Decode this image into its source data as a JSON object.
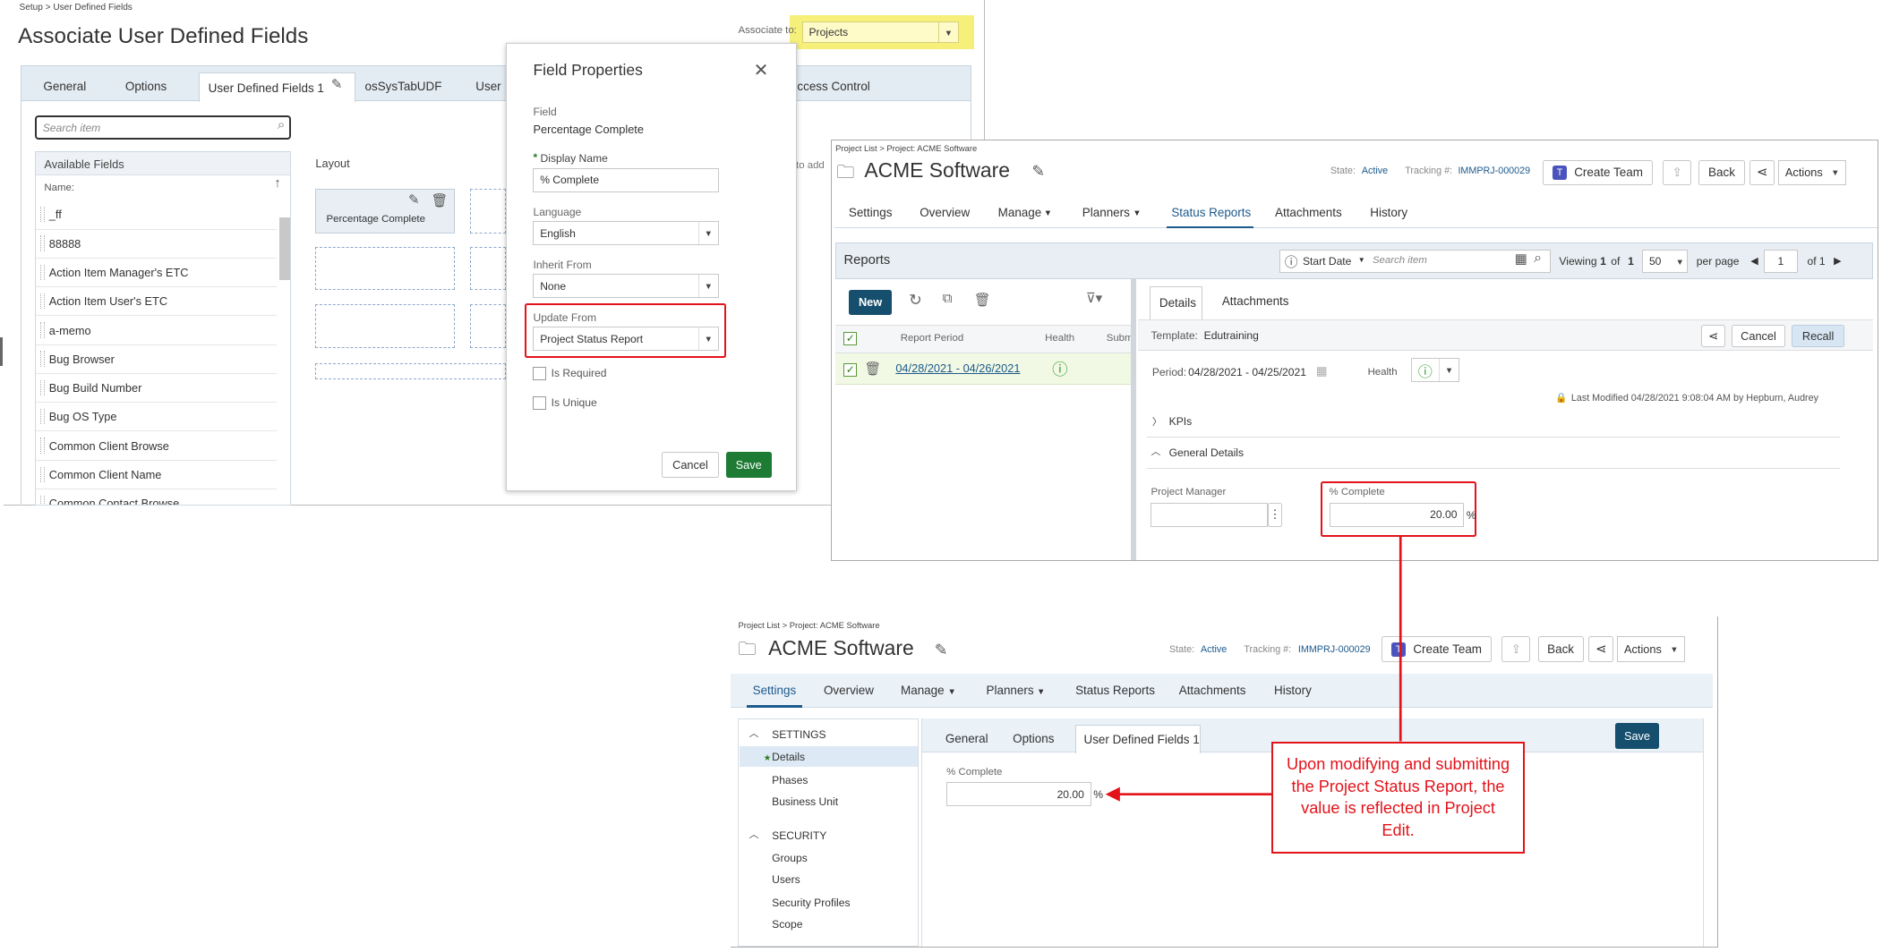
{
  "udf": {
    "breadcrumb": "Setup > User Defined Fields",
    "title": "Associate User Defined Fields",
    "associate_label": "Associate to:",
    "associate_value": "Projects",
    "tabs": [
      "General",
      "Options",
      "User Defined Fields 1",
      "osSysTabUDF",
      "User",
      "ccess Control"
    ],
    "search_placeholder": "Search item",
    "available_fields_header": "Available Fields",
    "name_header": "Name:",
    "fields": [
      "_ff",
      "88888",
      "Action Item Manager's ETC",
      "Action Item User's ETC",
      "a-memo",
      "Bug Browser",
      "Bug Build Number",
      "Bug OS Type",
      "Common Client Browse",
      "Common Client Name",
      "Common Contact Browse"
    ],
    "layout_label": "Layout",
    "add_text": "to add",
    "layout_card": "Percentage Complete"
  },
  "dialog": {
    "title": "Field Properties",
    "field_label": "Field",
    "field_value": "Percentage Complete",
    "display_name_label": "Display Name",
    "required_star": "*",
    "display_name_value": "% Complete",
    "language_label": "Language",
    "language_value": "English",
    "inherit_label": "Inherit From",
    "inherit_value": "None",
    "update_label": "Update From",
    "update_value": "Project Status Report",
    "is_required": "Is Required",
    "is_unique": "Is Unique",
    "cancel": "Cancel",
    "save": "Save"
  },
  "project1": {
    "breadcrumb": "Project List > Project: ACME Software",
    "title": "ACME Software",
    "state_label": "State:",
    "state_value": "Active",
    "tracking_label": "Tracking #:",
    "tracking_value": "IMMPRJ-000029",
    "create_team": "Create Team",
    "back": "Back",
    "actions": "Actions",
    "nav": [
      "Settings",
      "Overview",
      "Manage",
      "Planners",
      "Status Reports",
      "Attachments",
      "History"
    ],
    "reports_title": "Reports",
    "sort_label": "Start Date",
    "search_placeholder": "Search item",
    "viewing_prefix": "Viewing",
    "viewing_range": "1",
    "viewing_of": "of",
    "viewing_total": "1",
    "per_page_value": "50",
    "per_page_label": "per page",
    "page_value": "1",
    "page_of": "of 1",
    "new": "New",
    "col_period": "Report Period",
    "col_health": "Health",
    "col_submit": "Subm",
    "row_period": "04/28/2021 - 04/26/2021",
    "detail_tabs": [
      "Details",
      "Attachments"
    ],
    "template_label": "Template:",
    "template_value": "Edutraining",
    "cancel": "Cancel",
    "recall": "Recall",
    "period_label": "Period:",
    "period_value": "04/28/2021 - 04/25/2021",
    "health_label": "Health",
    "last_modified": "Last Modified 04/28/2021 9:08:04 AM by Hepburn, Audrey",
    "kpis": "KPIs",
    "general_details": "General Details",
    "pm_label": "Project Manager",
    "pc_label": "% Complete",
    "pc_value": "20.00",
    "pc_unit": "%"
  },
  "project2": {
    "breadcrumb": "Project List > Project: ACME Software",
    "title": "ACME Software",
    "state_label": "State:",
    "state_value": "Active",
    "tracking_label": "Tracking #:",
    "tracking_value": "IMMPRJ-000029",
    "create_team": "Create Team",
    "back": "Back",
    "actions": "Actions",
    "nav": [
      "Settings",
      "Overview",
      "Manage",
      "Planners",
      "Status Reports",
      "Attachments",
      "History"
    ],
    "settings_section": "SETTINGS",
    "settings_items": [
      "Details",
      "Phases",
      "Business Unit"
    ],
    "security_section": "SECURITY",
    "security_items": [
      "Groups",
      "Users",
      "Security Profiles",
      "Scope"
    ],
    "content_tabs": [
      "General",
      "Options",
      "User Defined Fields 1"
    ],
    "save": "Save",
    "pc_label": "% Complete",
    "pc_value": "20.00",
    "pc_unit": "%"
  },
  "callout": "Upon modifying and submitting the Project Status Report, the value is reflected in Project Edit.",
  "colors": {
    "highlight": "#e3131a",
    "accent": "#1d5a8c",
    "save_green": "#1e7b34",
    "associate_yellow": "#f6f07a"
  }
}
